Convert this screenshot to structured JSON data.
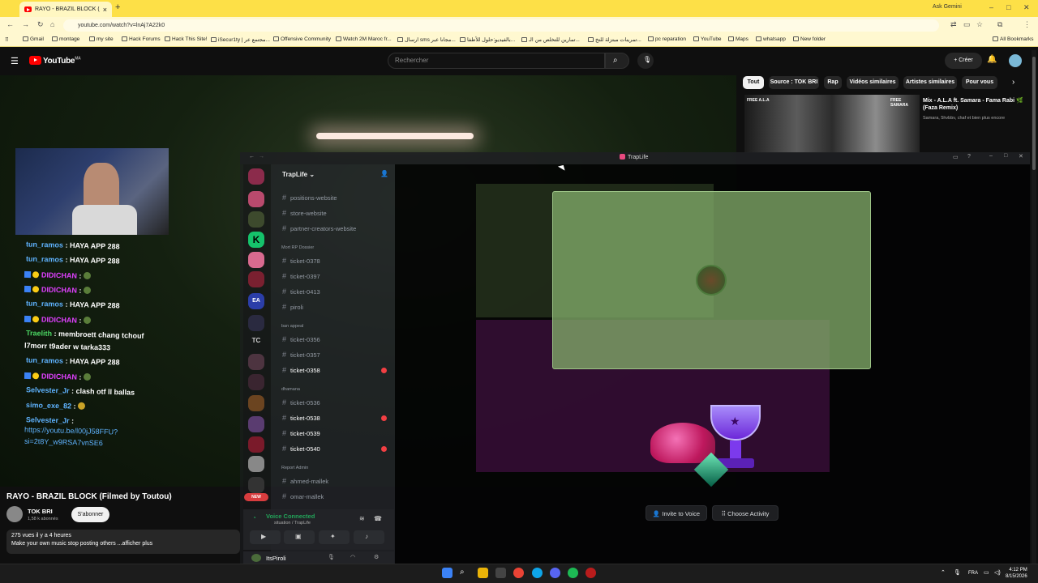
{
  "browser": {
    "tab_title": "RAYO - BRAZIL BLOCK (Filmed",
    "new_tab": "+",
    "ask_gemini": "Ask Gemini",
    "url": "youtube.com/watch?v=lnAj7A22k0",
    "bookmarks": [
      "Gmail",
      "montage",
      "my site",
      "Hack Forums",
      "Hack This Site!",
      "iSecur1ty | مجتمع عر...",
      "Offensive Community",
      "Watch 2M Maroc fr...",
      "ارسال sms مجانا عبر...",
      "بالفيديو:حلول للأطفا...",
      "تمارين للتخلص من الـ...",
      "تمرينات مبتزلة للتخ...",
      "pc reparation",
      "YouTube",
      "Maps",
      "whatsapp",
      "New folder"
    ],
    "all_bookmarks": "All Bookmarks"
  },
  "youtube": {
    "logo": "YouTube",
    "logo_region": "MA",
    "search_placeholder": "Rechercher",
    "create_label": "+ Créer",
    "chips": [
      "Tout",
      "Source : TOK BRI",
      "Rap",
      "Vidéos similaires",
      "Artistes similaires",
      "Pour vous"
    ],
    "recommendation": {
      "thumb_left": "FREE A.L.A",
      "thumb_right": "FREE SAMARA",
      "title": "Mix - A.L.A ft. Samara - Fama Rabi 🌿 (Faza Remix)",
      "subtitle": "Samara, 5hvbbv, chaf et bien plus encore"
    },
    "video_title": "RAYO - BRAZIL BLOCK (Filmed by Toutou)",
    "channel_name": "TOK BRI",
    "channel_subs": "1,58 k abonnés",
    "subscribe_label": "S'abonner",
    "views": "275 vues  il y a 4 heures",
    "description": "Make your own music stop posting others ...afficher plus"
  },
  "stream_chat": [
    {
      "user": "tun_ramos",
      "msg": ": HAYA APP 288",
      "color": "u"
    },
    {
      "user": "tun_ramos",
      "msg": ": HAYA APP 288",
      "color": "u"
    },
    {
      "user": "DIDICHAN",
      "msg": ":",
      "color": "p"
    },
    {
      "user": "DIDICHAN",
      "msg": ":",
      "color": "p"
    },
    {
      "user": "tun_ramos",
      "msg": ": HAYA APP 288",
      "color": "u"
    },
    {
      "user": "DIDICHAN",
      "msg": ":",
      "color": "p"
    },
    {
      "user": "Traelith",
      "msg": ": membroett chang tchouf",
      "color": "g"
    },
    {
      "user": "",
      "msg": "l7morr t9ader w tarka333",
      "color": "u"
    },
    {
      "user": "tun_ramos",
      "msg": ": HAYA APP 288",
      "color": "u"
    },
    {
      "user": "DIDICHAN",
      "msg": ":",
      "color": "p"
    },
    {
      "user": "Selvester_Jr",
      "msg": ": clash otf ll ballas",
      "color": "u"
    },
    {
      "user": "simo_exe_82",
      "msg": ":",
      "color": "u"
    },
    {
      "user": "Selvester_Jr",
      "msg": ":",
      "color": "u"
    },
    {
      "user": "",
      "msg": "https://youtu.be/l00jJ58FFU?",
      "color": "u"
    },
    {
      "user": "",
      "msg": "si=2t8Y_w9RSA7vnSE6",
      "color": "u"
    }
  ],
  "discord": {
    "window_title": "TrapLife",
    "server_name": "TrapLife",
    "channels": [
      {
        "name": "positions-website",
        "active": false
      },
      {
        "name": "store-website",
        "active": false
      },
      {
        "name": "partner-creators-website",
        "active": false
      },
      {
        "name": "ticket-0378",
        "active": false
      },
      {
        "name": "ticket-0397",
        "active": false
      },
      {
        "name": "ticket-0413",
        "active": false
      },
      {
        "name": "piroli",
        "active": false
      },
      {
        "name": "ticket-0356",
        "active": false
      },
      {
        "name": "ticket-0357",
        "active": false
      },
      {
        "name": "ticket-0358",
        "active": true
      },
      {
        "name": "ticket-0536",
        "active": false
      },
      {
        "name": "ticket-0538",
        "active": true
      },
      {
        "name": "ticket-0539",
        "active": true
      },
      {
        "name": "ticket-0540",
        "active": true
      },
      {
        "name": "ahmed-mallek",
        "active": false
      },
      {
        "name": "omar-mallek",
        "active": false
      }
    ],
    "categories": [
      "Mort RP Dossier",
      "ban appeal",
      "dhamana",
      "Report Admin"
    ],
    "server_tc": "TC",
    "new_badge": "NEW",
    "voice_connected": "Voice Connected",
    "voice_channel": "situation / TrapLife",
    "username": "ItsPiroli",
    "invite_to_voice": "Invite to Voice",
    "choose_activity": "Choose Activity"
  },
  "taskbar": {
    "lang": "FRA",
    "time": "4:12 PM",
    "date": "8/15/2026"
  }
}
